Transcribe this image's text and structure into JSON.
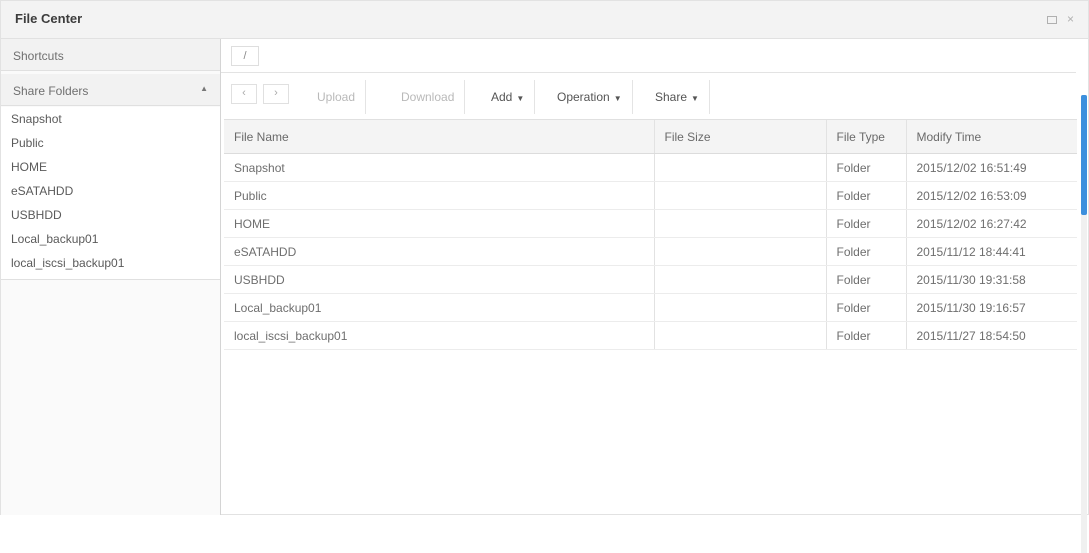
{
  "window": {
    "title": "File Center",
    "controls": {
      "restore": "restore-icon",
      "close_label": "×"
    }
  },
  "sidebar": {
    "shortcuts_label": "Shortcuts",
    "share_folders_label": "Share Folders",
    "share_folders_caret": "▲",
    "folders": [
      "Snapshot",
      "Public",
      "HOME",
      "eSATAHDD",
      "USBHDD",
      "Local_backup01",
      "local_iscsi_backup01"
    ]
  },
  "path": {
    "current": "/"
  },
  "toolbar": {
    "back_label": "‹",
    "forward_label": "›",
    "upload_label": "Upload",
    "download_label": "Download",
    "add_label": "Add",
    "operation_label": "Operation",
    "share_label": "Share",
    "dropdown_glyph": "▼"
  },
  "table": {
    "columns": [
      "File Name",
      "File Size",
      "File Type",
      "Modify Time"
    ],
    "rows": [
      {
        "name": "Snapshot",
        "size": "",
        "type": "Folder",
        "modified": "2015/12/02 16:51:49"
      },
      {
        "name": "Public",
        "size": "",
        "type": "Folder",
        "modified": "2015/12/02 16:53:09"
      },
      {
        "name": "HOME",
        "size": "",
        "type": "Folder",
        "modified": "2015/12/02 16:27:42"
      },
      {
        "name": "eSATAHDD",
        "size": "",
        "type": "Folder",
        "modified": "2015/11/12 18:44:41"
      },
      {
        "name": "USBHDD",
        "size": "",
        "type": "Folder",
        "modified": "2015/11/30 19:31:58"
      },
      {
        "name": "Local_backup01",
        "size": "",
        "type": "Folder",
        "modified": "2015/11/30 19:16:57"
      },
      {
        "name": "local_iscsi_backup01",
        "size": "",
        "type": "Folder",
        "modified": "2015/11/27 18:54:50"
      }
    ]
  },
  "colors": {
    "accent": "#3c8fdd",
    "header_bg": "#f3f3f3"
  }
}
